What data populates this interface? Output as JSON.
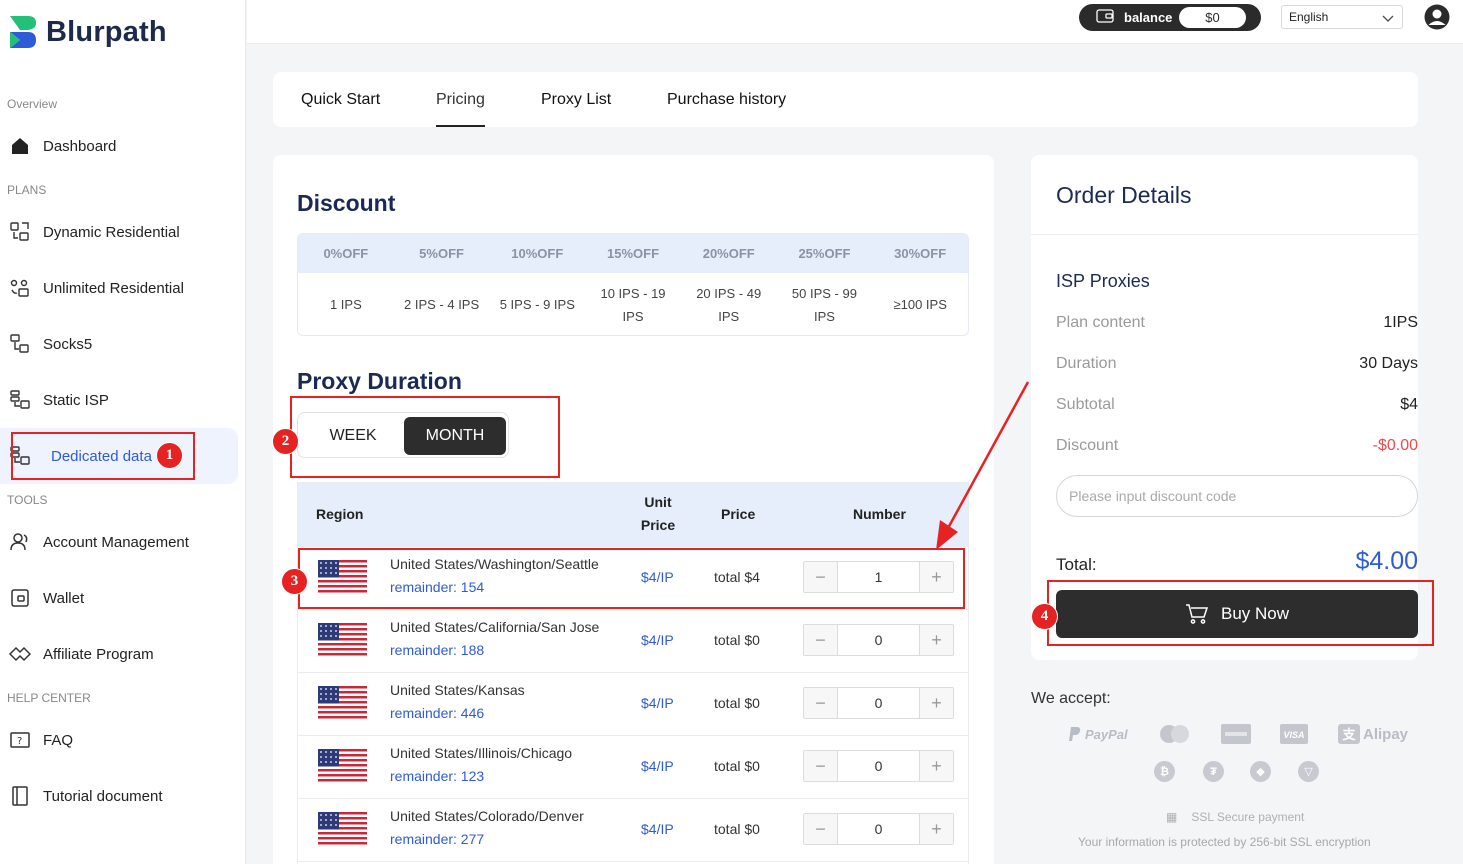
{
  "brand": {
    "name": "Blurpath"
  },
  "sidebar": {
    "sections": {
      "overview": "Overview",
      "plans": "PLANS",
      "tools": "TOOLS",
      "help": "HELP CENTER"
    },
    "items": [
      {
        "label": "Dashboard",
        "icon": "home-icon"
      },
      {
        "label": "Dynamic Residential",
        "icon": "dynamic-residential-icon"
      },
      {
        "label": "Unlimited Residential",
        "icon": "unlimited-residential-icon"
      },
      {
        "label": "Socks5",
        "icon": "socks5-icon"
      },
      {
        "label": "Static ISP",
        "icon": "static-isp-icon"
      },
      {
        "label": "Dedicated data",
        "icon": "dedicated-data-icon",
        "active": true
      },
      {
        "label": "Account Management",
        "icon": "account-icon"
      },
      {
        "label": "Wallet",
        "icon": "wallet-icon"
      },
      {
        "label": "Affiliate Program",
        "icon": "affiliate-icon"
      },
      {
        "label": "FAQ",
        "icon": "faq-icon"
      },
      {
        "label": "Tutorial document",
        "icon": "document-icon"
      }
    ]
  },
  "header": {
    "balance_label": "balance",
    "balance_value": "$0",
    "language": "English"
  },
  "tabs": [
    {
      "label": "Quick Start"
    },
    {
      "label": "Pricing",
      "active": true
    },
    {
      "label": "Proxy List"
    },
    {
      "label": "Purchase history"
    }
  ],
  "discount": {
    "title": "Discount",
    "headers": [
      "0%OFF",
      "5%OFF",
      "10%OFF",
      "15%OFF",
      "20%OFF",
      "25%OFF",
      "30%OFF"
    ],
    "ranges": [
      "1 IPS",
      "2 IPS - 4 IPS",
      "5 IPS - 9 IPS",
      "10 IPS - 19 IPS",
      "20 IPS - 49 IPS",
      "50 IPS - 99 IPS",
      "≥100 IPS"
    ]
  },
  "duration": {
    "title": "Proxy Duration",
    "options": [
      "WEEK",
      "MONTH"
    ],
    "selected": "MONTH"
  },
  "products": {
    "headers": {
      "region": "Region",
      "unit_price": "Unit Price",
      "price": "Price",
      "number": "Number"
    },
    "rows": [
      {
        "location": "United States/Washington/Seattle",
        "remainder": "remainder: 154",
        "unit_price": "$4/IP",
        "total": "total $4",
        "number": "1"
      },
      {
        "location": "United States/California/San Jose",
        "remainder": "remainder: 188",
        "unit_price": "$4/IP",
        "total": "total $0",
        "number": "0"
      },
      {
        "location": "United States/Kansas",
        "remainder": "remainder: 446",
        "unit_price": "$4/IP",
        "total": "total $0",
        "number": "0"
      },
      {
        "location": "United States/Illinois/Chicago",
        "remainder": "remainder: 123",
        "unit_price": "$4/IP",
        "total": "total $0",
        "number": "0"
      },
      {
        "location": "United States/Colorado/Denver",
        "remainder": "remainder: 277",
        "unit_price": "$4/IP",
        "total": "total $0",
        "number": "0"
      }
    ]
  },
  "order": {
    "title": "Order Details",
    "product": "ISP Proxies",
    "plan_content_label": "Plan content",
    "plan_content_value": "1IPS",
    "duration_label": "Duration",
    "duration_value": "30 Days",
    "subtotal_label": "Subtotal",
    "subtotal_value": "$4",
    "discount_label": "Discount",
    "discount_value": "-$0.00",
    "discount_placeholder": "Please input discount code",
    "total_label": "Total:",
    "total_value": "$4.00",
    "buy_label": "Buy Now"
  },
  "payment": {
    "accept_title": "We accept:",
    "methods": [
      "PayPal",
      "Mastercard",
      "Amex",
      "VISA",
      "Alipay"
    ],
    "crypto": [
      "bitcoin-icon",
      "tether-icon",
      "ethereum-icon",
      "tron-icon"
    ],
    "ssl_label": "SSL Secure payment",
    "ssl_note": "Your information is protected by 256-bit SSL encryption"
  },
  "annotations": [
    "1",
    "2",
    "3",
    "4"
  ],
  "colors": {
    "accent": "#2f5bd8",
    "dark": "#2d2d2d",
    "annotation": "#e52323",
    "discount_red": "#f04a4a"
  }
}
